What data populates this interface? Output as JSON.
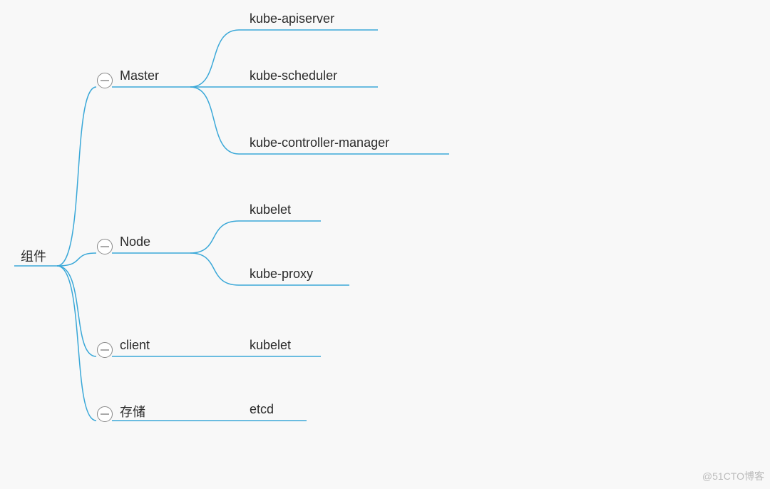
{
  "root": {
    "label": "组件"
  },
  "branches": [
    {
      "key": "master",
      "label": "Master",
      "children": [
        {
          "key": "kube-apiserver",
          "label": "kube-apiserver"
        },
        {
          "key": "kube-scheduler",
          "label": "kube-scheduler"
        },
        {
          "key": "kube-controller-manager",
          "label": "kube-controller-manager"
        }
      ]
    },
    {
      "key": "node",
      "label": "Node",
      "children": [
        {
          "key": "kubelet",
          "label": "kubelet"
        },
        {
          "key": "kube-proxy",
          "label": "kube-proxy"
        }
      ]
    },
    {
      "key": "client",
      "label": "client",
      "children": [
        {
          "key": "kubelet-client",
          "label": "kubelet"
        }
      ]
    },
    {
      "key": "storage",
      "label": "存储",
      "children": [
        {
          "key": "etcd",
          "label": "etcd"
        }
      ]
    }
  ],
  "watermark": "@51CTO博客",
  "colors": {
    "line": "#3aa8d8",
    "text": "#2a2a2a"
  }
}
